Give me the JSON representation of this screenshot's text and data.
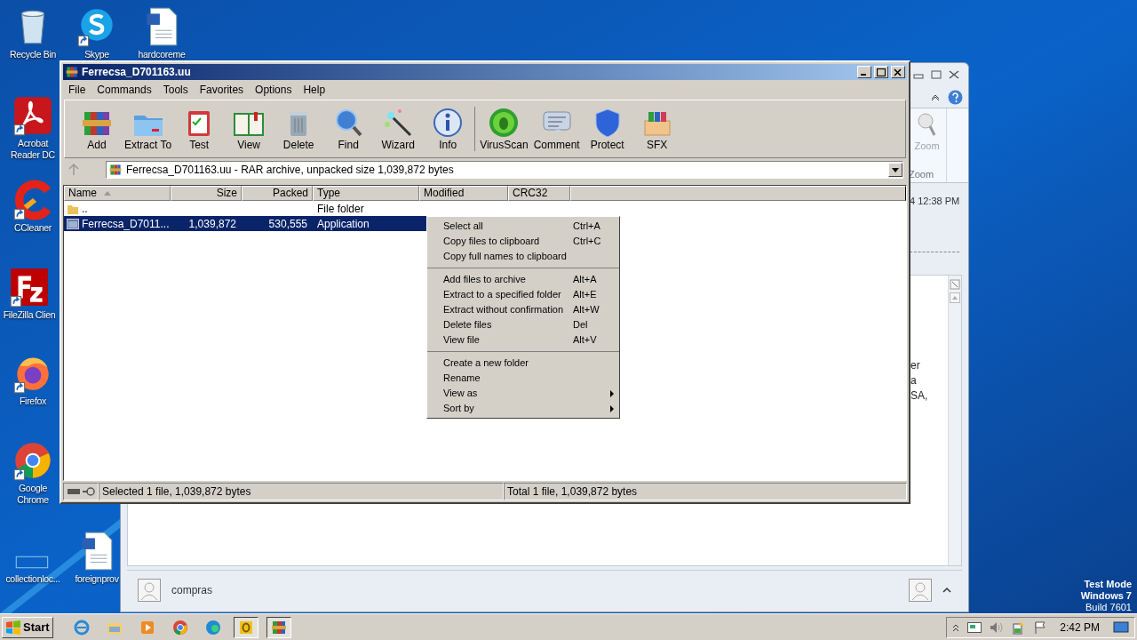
{
  "desktop_icons": [
    {
      "label": "Recycle Bin",
      "kind": "recycle",
      "shortcut": false
    },
    {
      "label": "Skype",
      "kind": "skype",
      "shortcut": true
    },
    {
      "label": "hardcoreme",
      "kind": "word",
      "shortcut": false
    },
    {
      "label": "Acrobat Reader DC",
      "kind": "acrobat",
      "shortcut": true
    },
    {
      "label": "CCleaner",
      "kind": "ccleaner",
      "shortcut": true
    },
    {
      "label": "FileZilla Clien",
      "kind": "filezilla",
      "shortcut": true
    },
    {
      "label": "Firefox",
      "kind": "firefox",
      "shortcut": true
    },
    {
      "label": "Google Chrome",
      "kind": "chrome",
      "shortcut": true
    },
    {
      "label": "collectionloc...",
      "kind": "blank",
      "shortcut": false
    },
    {
      "label": "foreignprov",
      "kind": "word",
      "shortcut": false
    }
  ],
  "mail_window": {
    "ribbon_button": "Zoom",
    "ribbon_group": "Zoom",
    "timestamp": "4 12:38 PM",
    "body_lines": [
      "er",
      "a",
      "SA,"
    ],
    "sender": "compras"
  },
  "archiver": {
    "title": "Ferrecsa_D701163.uu",
    "menu": [
      "File",
      "Commands",
      "Tools",
      "Favorites",
      "Options",
      "Help"
    ],
    "toolbar": [
      [
        {
          "label": "Add",
          "kind": "add"
        },
        {
          "label": "Extract To",
          "kind": "extract"
        },
        {
          "label": "Test",
          "kind": "test"
        },
        {
          "label": "View",
          "kind": "view"
        },
        {
          "label": "Delete",
          "kind": "delete"
        },
        {
          "label": "Find",
          "kind": "find"
        },
        {
          "label": "Wizard",
          "kind": "wizard"
        },
        {
          "label": "Info",
          "kind": "info"
        }
      ],
      [
        {
          "label": "VirusScan",
          "kind": "virus"
        },
        {
          "label": "Comment",
          "kind": "comment"
        },
        {
          "label": "Protect",
          "kind": "protect"
        },
        {
          "label": "SFX",
          "kind": "sfx"
        }
      ]
    ],
    "path": "Ferrecsa_D701163.uu - RAR archive, unpacked size 1,039,872 bytes",
    "columns": [
      "Name",
      "Size",
      "Packed",
      "Type",
      "Modified",
      "CRC32"
    ],
    "rows": [
      {
        "kind": "folder",
        "name": "..",
        "size": "",
        "packed": "",
        "type": "File folder",
        "selected": false
      },
      {
        "kind": "app",
        "name": "Ferrecsa_D7011...",
        "size": "1,039,872",
        "packed": "530,555",
        "type": "Application",
        "selected": true
      }
    ],
    "status_left": "Selected 1 file, 1,039,872 bytes",
    "status_right": "Total 1 file, 1,039,872 bytes"
  },
  "context_menu": [
    [
      {
        "label": "Select all",
        "shortcut": "Ctrl+A",
        "submenu": false
      },
      {
        "label": "Copy files to clipboard",
        "shortcut": "Ctrl+C",
        "submenu": false
      },
      {
        "label": "Copy full names to clipboard",
        "submenu": false
      }
    ],
    [
      {
        "label": "Add files to archive",
        "shortcut": "Alt+A",
        "submenu": false
      },
      {
        "label": "Extract to a specified folder",
        "shortcut": "Alt+E",
        "submenu": false
      },
      {
        "label": "Extract without confirmation",
        "shortcut": "Alt+W",
        "submenu": false
      },
      {
        "label": "Delete files",
        "shortcut": "Del",
        "submenu": false
      },
      {
        "label": "View file",
        "shortcut": "Alt+V",
        "submenu": false
      }
    ],
    [
      {
        "label": "Create a new folder",
        "submenu": false
      },
      {
        "label": "Rename",
        "submenu": false
      },
      {
        "label": "View as",
        "submenu": true
      },
      {
        "label": "Sort by",
        "submenu": true
      }
    ]
  ],
  "os_notice": [
    "Test Mode",
    "Windows 7",
    "Build 7601"
  ],
  "taskbar": {
    "start": "Start",
    "apps": [
      {
        "kind": "ie",
        "open": false
      },
      {
        "kind": "explorer",
        "open": false
      },
      {
        "kind": "media",
        "open": false
      },
      {
        "kind": "chrome",
        "open": false
      },
      {
        "kind": "edge",
        "open": false
      },
      {
        "kind": "outlook",
        "open": true
      },
      {
        "kind": "winrar",
        "open": true
      }
    ],
    "clock": "2:42 PM"
  }
}
